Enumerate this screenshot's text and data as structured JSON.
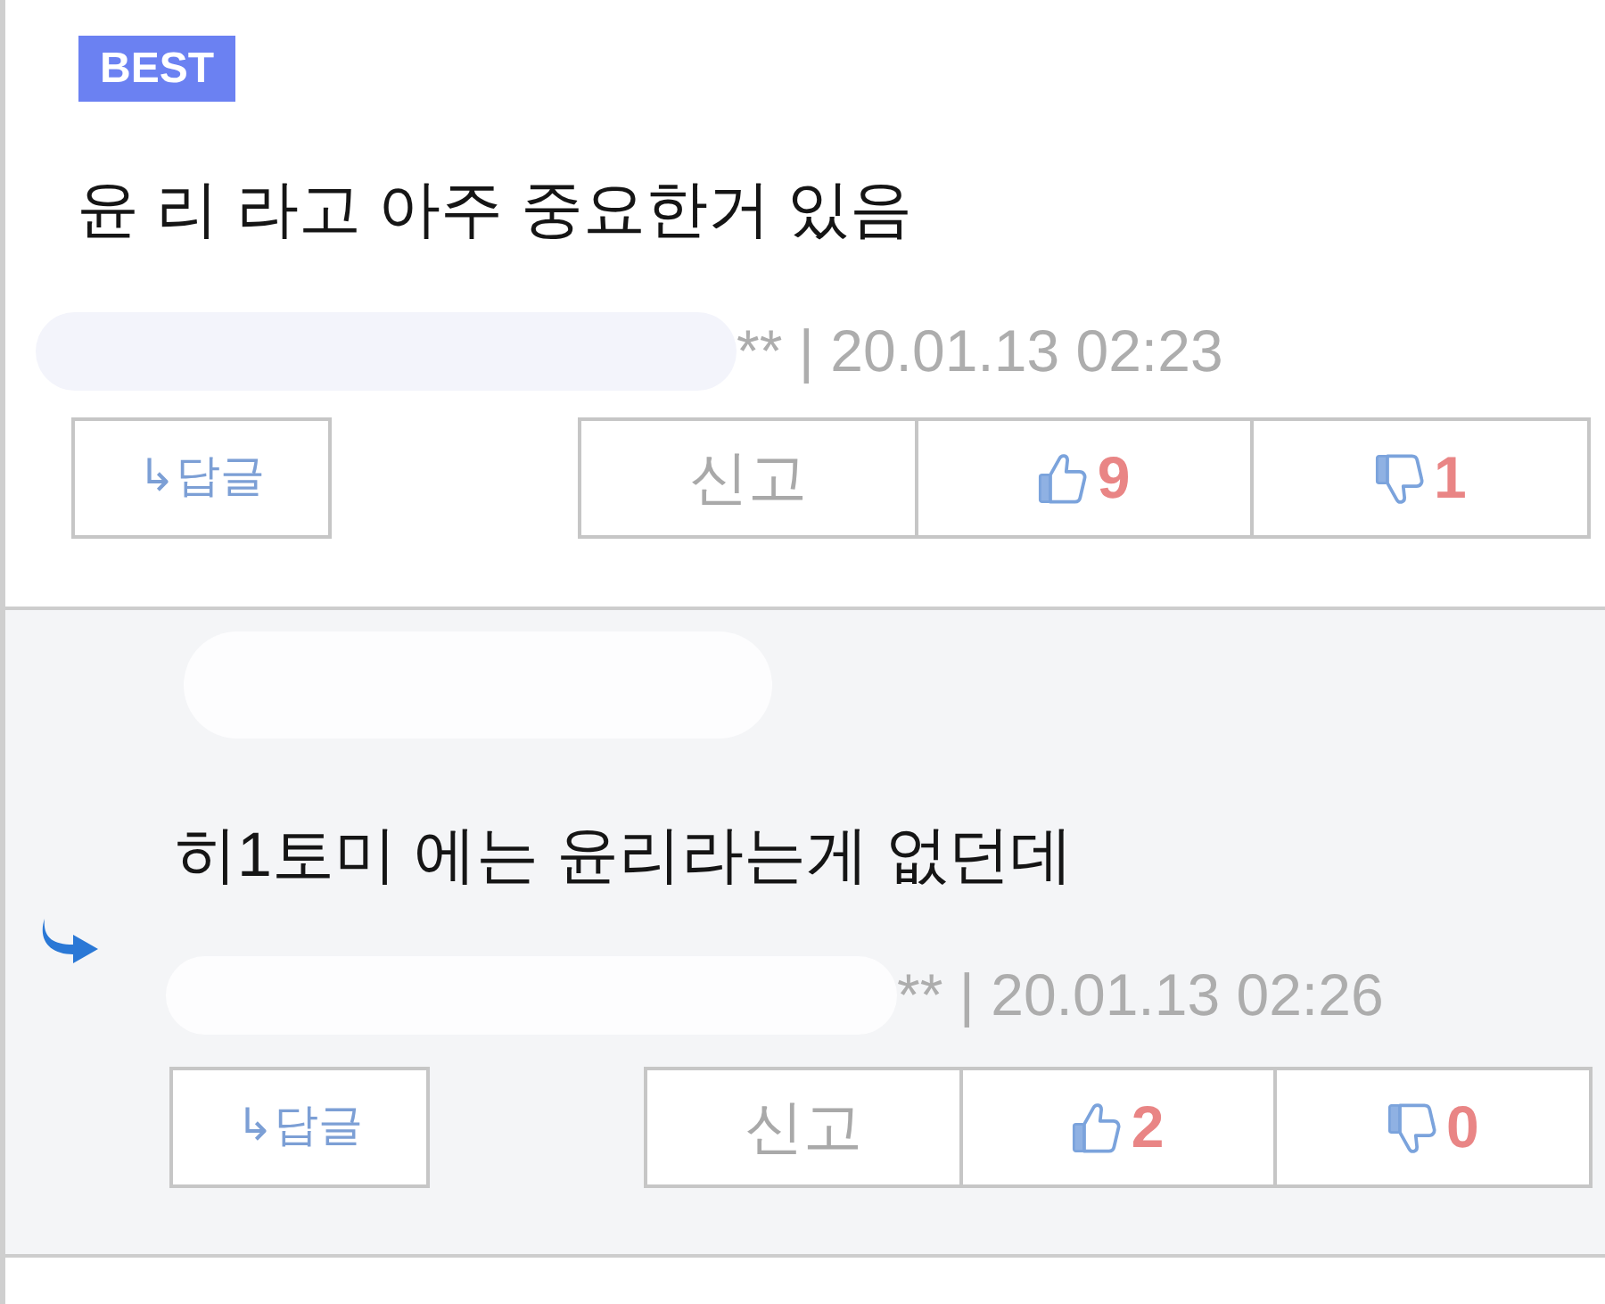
{
  "comments": [
    {
      "badge": "BEST",
      "is_reply": false,
      "author_redacted": true,
      "text": "윤 리 라고 아주 중요한거 있음",
      "meta": "** | 20.01.13 02:23",
      "actions": {
        "reply": "↳답글",
        "report": "신고",
        "likes": "9",
        "dislikes": "1"
      }
    },
    {
      "is_reply": true,
      "author_redacted": true,
      "text": "히1토미 에는 윤리라는게 없던데",
      "meta": "** | 20.01.13 02:26",
      "actions": {
        "reply": "↳답글",
        "report": "신고",
        "likes": "2",
        "dislikes": "0"
      }
    }
  ]
}
